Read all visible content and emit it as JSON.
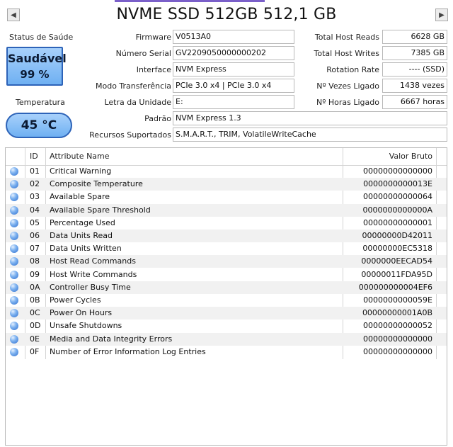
{
  "header": {
    "title": "NVME SSD 512GB 512,1 GB",
    "prev_icon": "◀",
    "next_icon": "▶"
  },
  "health": {
    "label": "Status de Saúde",
    "status": "Saudável",
    "percent": "99 %",
    "color": "#7fb9f5"
  },
  "temperature": {
    "label": "Temperatura",
    "value": "45 °C"
  },
  "info": {
    "firmware_label": "Firmware",
    "firmware": "V0513A0",
    "serial_label": "Número Serial",
    "serial": "GV2209050000000202",
    "interface_label": "Interface",
    "interface": "NVM Express",
    "transfer_label": "Modo Transferência",
    "transfer": "PCIe 3.0 x4 | PCIe 3.0 x4",
    "drive_letter_label": "Letra da Unidade",
    "drive_letter": "E:",
    "standard_label": "Padrão",
    "standard": "NVM Express 1.3",
    "features_label": "Recursos Suportados",
    "features": "S.M.A.R.T., TRIM, VolatileWriteCache"
  },
  "stats": {
    "host_reads_label": "Total Host Reads",
    "host_reads": "6628 GB",
    "host_writes_label": "Total Host Writes",
    "host_writes": "7385 GB",
    "rotation_label": "Rotation Rate",
    "rotation": "---- (SSD)",
    "power_count_label": "Nº Vezes Ligado",
    "power_count": "1438 vezes",
    "power_hours_label": "Nº Horas Ligado",
    "power_hours": "6667 horas"
  },
  "table": {
    "headers": {
      "id": "ID",
      "name": "Attribute Name",
      "raw": "Valor Bruto"
    },
    "rows": [
      {
        "id": "01",
        "name": "Critical Warning",
        "raw": "00000000000000"
      },
      {
        "id": "02",
        "name": "Composite Temperature",
        "raw": "0000000000013E"
      },
      {
        "id": "03",
        "name": "Available Spare",
        "raw": "00000000000064"
      },
      {
        "id": "04",
        "name": "Available Spare Threshold",
        "raw": "0000000000000A"
      },
      {
        "id": "05",
        "name": "Percentage Used",
        "raw": "00000000000001"
      },
      {
        "id": "06",
        "name": "Data Units Read",
        "raw": "00000000D42011"
      },
      {
        "id": "07",
        "name": "Data Units Written",
        "raw": "00000000EC5318"
      },
      {
        "id": "08",
        "name": "Host Read Commands",
        "raw": "0000000EECAD54"
      },
      {
        "id": "09",
        "name": "Host Write Commands",
        "raw": "00000011FDA95D"
      },
      {
        "id": "0A",
        "name": "Controller Busy Time",
        "raw": "000000000004EF6"
      },
      {
        "id": "0B",
        "name": "Power Cycles",
        "raw": "0000000000059E"
      },
      {
        "id": "0C",
        "name": "Power On Hours",
        "raw": "00000000001A0B"
      },
      {
        "id": "0D",
        "name": "Unsafe Shutdowns",
        "raw": "00000000000052"
      },
      {
        "id": "0E",
        "name": "Media and Data Integrity Errors",
        "raw": "00000000000000"
      },
      {
        "id": "0F",
        "name": "Number of Error Information Log Entries",
        "raw": "00000000000000"
      }
    ],
    "status_icon": "status-dot-good"
  }
}
